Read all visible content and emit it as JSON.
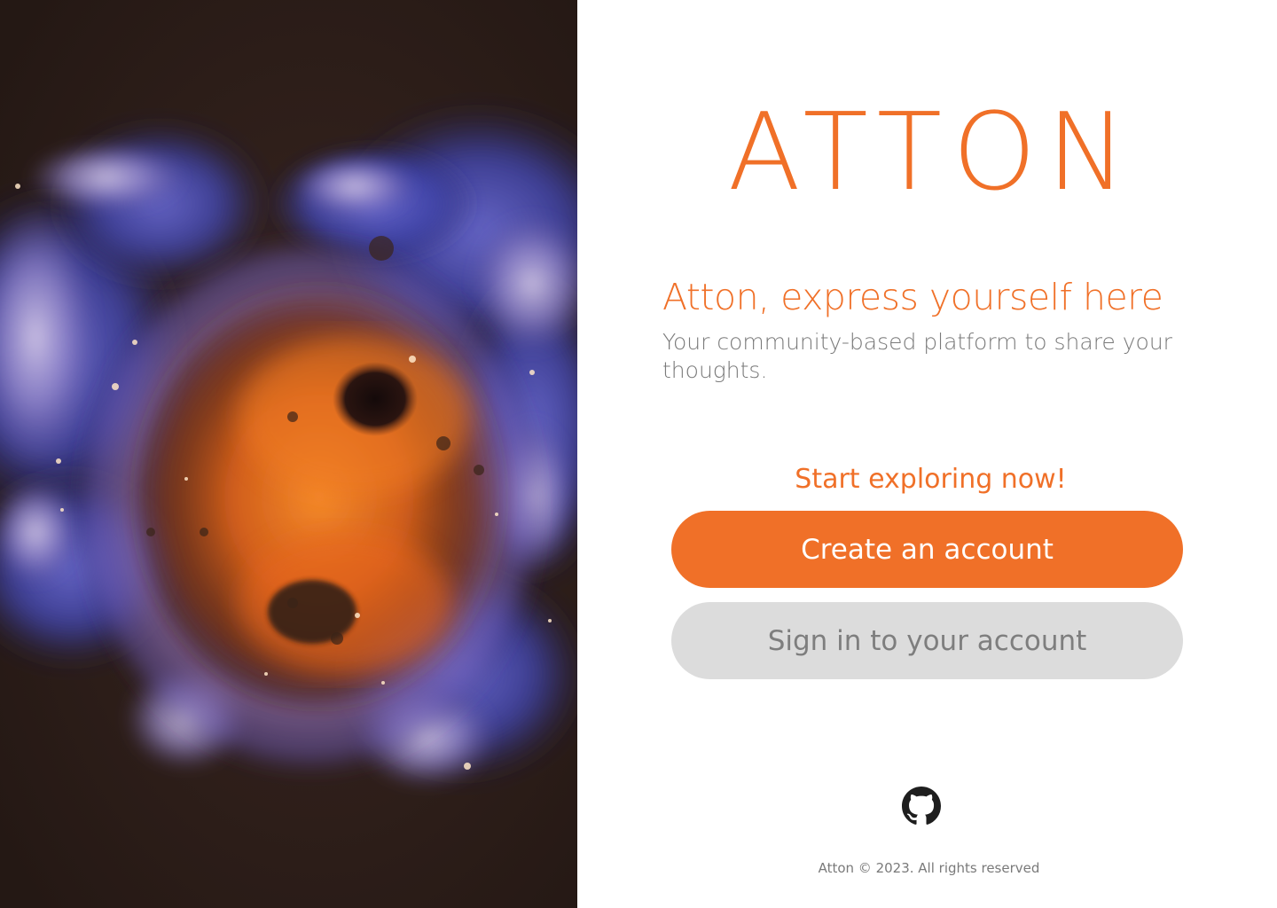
{
  "art": {
    "image_name": "nebula-abstract-painting",
    "colors": {
      "background": "#2a1c18",
      "blue": "#4a4fb0",
      "lavender": "#9a8ccc",
      "orange": "#e0661c",
      "dark_core": "#1e1210"
    }
  },
  "brand": {
    "logo_text": "ATTON",
    "accent_color": "#f07028"
  },
  "hero": {
    "title": "Atton, express yourself here",
    "subtitle": "Your community-based platform to share your thoughts."
  },
  "cta": {
    "heading": "Start exploring now!",
    "create_account_label": "Create an account",
    "sign_in_label": "Sign in to your account"
  },
  "footer": {
    "github_icon": "github-icon",
    "copyright": "Atton © 2023. All rights reserved"
  }
}
